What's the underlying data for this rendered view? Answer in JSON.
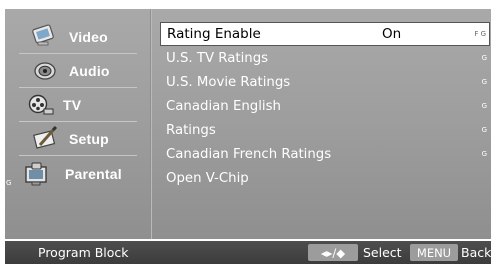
{
  "sidebar": {
    "items": [
      {
        "label": "Video",
        "icon": "video-icon"
      },
      {
        "label": "Audio",
        "icon": "audio-icon"
      },
      {
        "label": "TV",
        "icon": "tv-icon"
      },
      {
        "label": "Setup",
        "icon": "setup-icon"
      },
      {
        "label": "Parental",
        "icon": "parental-icon",
        "active": true
      }
    ],
    "side_mark": "G"
  },
  "menu": {
    "rows": [
      {
        "label": "Rating Enable",
        "value": "On",
        "mark": "F G",
        "selected": true
      },
      {
        "label": "U.S. TV Ratings",
        "mark": "G"
      },
      {
        "label": "U.S. Movie Ratings",
        "mark": "G"
      },
      {
        "label": "Canadian English",
        "mark": "G"
      },
      {
        "label": "Ratings",
        "mark": "G"
      },
      {
        "label": "Canadian French Ratings",
        "mark": "G"
      },
      {
        "label": "Open V-Chip"
      }
    ]
  },
  "bottom_bar": {
    "status": "Program Block",
    "nav_key": "◂▸/◆",
    "nav_hint": "Select",
    "menu_key": "MENU",
    "menu_hint": "Back"
  },
  "colors": {
    "panel": "#a0a0a0",
    "bottom_bar": "#444444",
    "key_badge": "#9c9c9c",
    "selected_row": "#ffffff"
  }
}
